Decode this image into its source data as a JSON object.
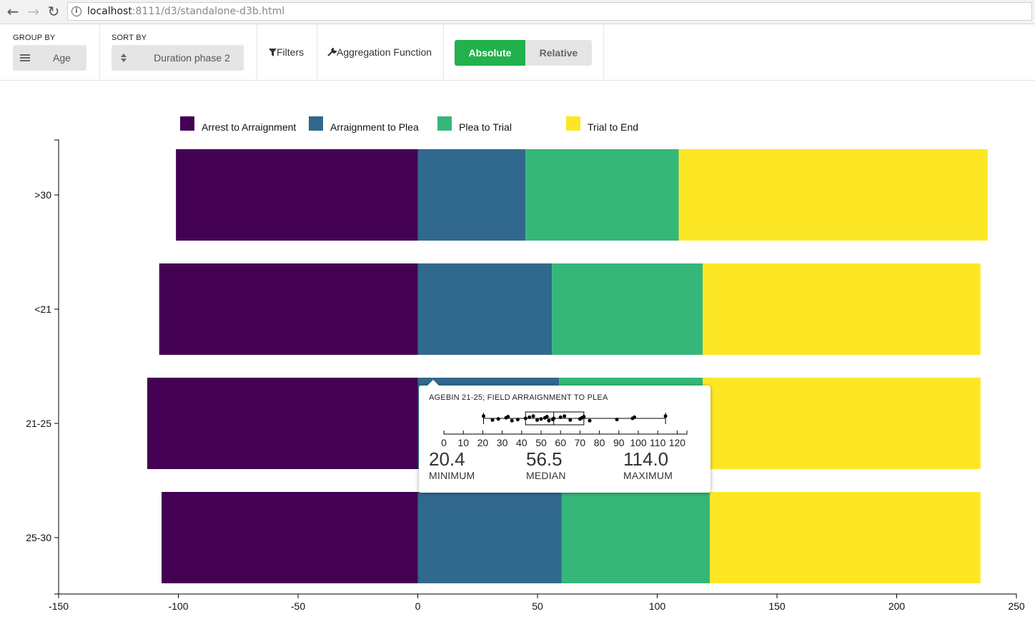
{
  "browser": {
    "url_host": "localhost",
    "url_rest": ":8111/d3/standalone-d3b.html",
    "back_glyph": "←",
    "forward_glyph": "→",
    "reload_glyph": "↻",
    "info_glyph": "i"
  },
  "toolbar": {
    "group_by_label": "GROUP BY",
    "group_by_value": "Age",
    "group_by_icon": "list-icon",
    "sort_by_label": "SORT BY",
    "sort_by_value": "Duration phase 2",
    "sort_by_icon": "sort-icon",
    "filters_label": "Filters",
    "filters_icon": "funnel-icon",
    "aggregation_label": "Aggregation Function",
    "aggregation_icon": "wrench-icon",
    "absolute_label": "Absolute",
    "relative_label": "Relative",
    "active_mode": "Absolute",
    "accent_color": "#22b14c"
  },
  "chart_data": {
    "type": "bar",
    "orientation": "horizontal-stacked-diverging",
    "categories": [
      ">30",
      "<21",
      "21-25",
      "25-30"
    ],
    "series": [
      {
        "name": "Arrest to Arraignment",
        "color": "#440154",
        "values": [
          101,
          108,
          113,
          107
        ]
      },
      {
        "name": "Arraignment to Plea",
        "color": "#31688e",
        "values": [
          45,
          56,
          59,
          60
        ]
      },
      {
        "name": "Plea to Trial",
        "color": "#35b779",
        "values": [
          64,
          63,
          60,
          62
        ]
      },
      {
        "name": "Trial to End",
        "color": "#fde725",
        "values": [
          129,
          116,
          116,
          113
        ]
      }
    ],
    "xlim": [
      -150,
      250
    ],
    "xticks": [
      -150,
      -100,
      -50,
      0,
      50,
      100,
      150,
      200,
      250
    ],
    "xtick_labels": [
      "-150",
      "-100",
      "-50",
      "0",
      "50",
      "100",
      "150",
      "200",
      "250"
    ],
    "legend_position": "top",
    "grid": false
  },
  "tooltip": {
    "title": "AGEBIN 21-25; FIELD ARRAIGNMENT TO PLEA",
    "min_value": "20.4",
    "median_value": "56.5",
    "max_value": "114.0",
    "min_label": "MINIMUM",
    "median_label": "MEDIAN",
    "max_label": "MAXIMUM",
    "axis_ticks": [
      "0",
      "10",
      "20",
      "30",
      "40",
      "50",
      "60",
      "70",
      "80",
      "90",
      "100",
      "110",
      "120"
    ],
    "box": {
      "min": 20.4,
      "q1": 42,
      "median": 56.5,
      "q3": 72,
      "max": 114.0
    },
    "points": [
      20.4,
      25,
      28,
      32,
      33,
      35,
      38,
      42,
      44,
      46,
      48,
      50,
      52,
      53,
      54,
      56,
      56.5,
      60,
      62,
      65,
      70,
      71,
      72,
      75,
      89,
      97,
      98,
      114
    ]
  }
}
